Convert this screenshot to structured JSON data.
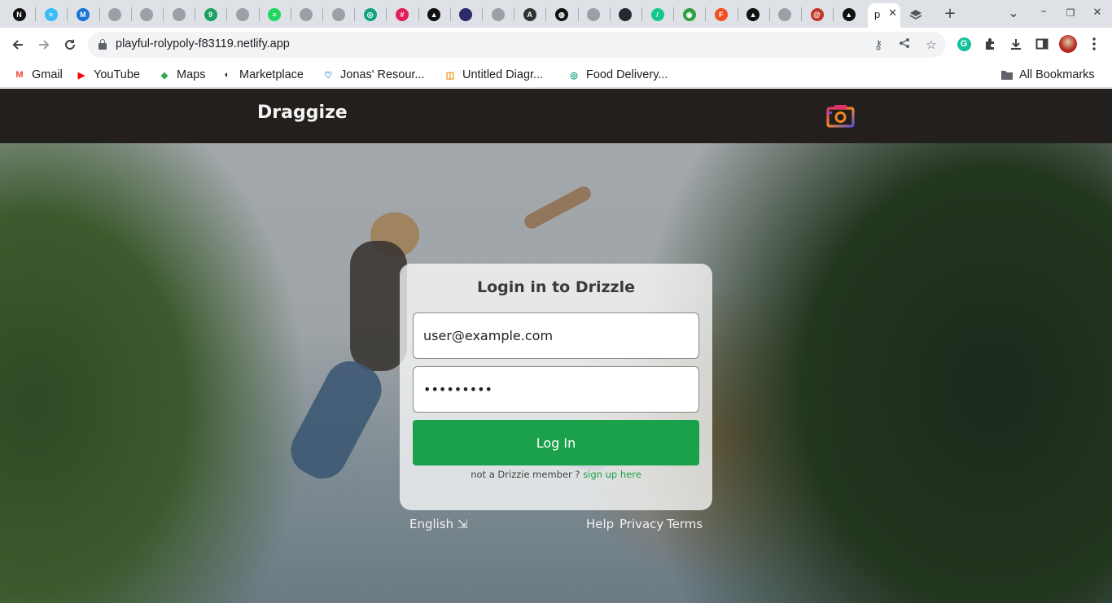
{
  "browser": {
    "tabs": [
      {
        "icon": "notion-icon",
        "color": "#111111",
        "glyph": "N"
      },
      {
        "icon": "tailwind-icon",
        "color": "#38bdf8",
        "glyph": "≈"
      },
      {
        "icon": "mui-icon",
        "color": "#1976d2",
        "glyph": "M"
      },
      {
        "icon": "globe-icon",
        "color": "#9aa0a6",
        "glyph": ""
      },
      {
        "icon": "globe-icon",
        "color": "#9aa0a6",
        "glyph": ""
      },
      {
        "icon": "globe-icon",
        "color": "#9aa0a6",
        "glyph": ""
      },
      {
        "icon": "nine-icon",
        "color": "#1aa260",
        "glyph": "9"
      },
      {
        "icon": "globe-icon",
        "color": "#9aa0a6",
        "glyph": ""
      },
      {
        "icon": "spotify-icon",
        "color": "#1ed760",
        "glyph": "≡"
      },
      {
        "icon": "github-icon",
        "color": "#9aa0a6",
        "glyph": ""
      },
      {
        "icon": "github-icon",
        "color": "#9aa0a6",
        "glyph": ""
      },
      {
        "icon": "chatgpt-icon",
        "color": "#10a37f",
        "glyph": "◎"
      },
      {
        "icon": "slack-icon",
        "color": "#e01e5a",
        "glyph": "#"
      },
      {
        "icon": "vercel-icon",
        "color": "#111111",
        "glyph": "▲"
      },
      {
        "icon": "profile-icon",
        "color": "#2b2b6b",
        "glyph": ""
      },
      {
        "icon": "globe-icon",
        "color": "#9aa0a6",
        "glyph": ""
      },
      {
        "icon": "a-icon",
        "color": "#333333",
        "glyph": "A"
      },
      {
        "icon": "openai-icon",
        "color": "#111111",
        "glyph": "◍"
      },
      {
        "icon": "github-icon",
        "color": "#9aa0a6",
        "glyph": ""
      },
      {
        "icon": "github-icon",
        "color": "#24292f",
        "glyph": ""
      },
      {
        "icon": "pencil-icon",
        "color": "#14c78a",
        "glyph": "/"
      },
      {
        "icon": "green-icon",
        "color": "#2e9e3f",
        "glyph": "◉"
      },
      {
        "icon": "figma-icon",
        "color": "#f24e1e",
        "glyph": "F"
      },
      {
        "icon": "vercel-icon",
        "color": "#111111",
        "glyph": "▲"
      },
      {
        "icon": "globe-icon",
        "color": "#9aa0a6",
        "glyph": ""
      },
      {
        "icon": "spiral-icon",
        "color": "#c0392b",
        "glyph": "@"
      },
      {
        "icon": "vercel-icon",
        "color": "#111111",
        "glyph": "▲"
      }
    ],
    "active_tab": {
      "label_fragment": "p",
      "close": "✕"
    },
    "extra_tab": {
      "icon": "layers-icon",
      "color": "#444444"
    },
    "new_tab": "+",
    "window_controls": {
      "dropdown": "⌄",
      "minimize": "–",
      "maximize": "❐",
      "close": "✕"
    },
    "url": "playful-rolypoly-f83119.netlify.app",
    "bookmarks": [
      {
        "label": "Gmail",
        "icon": "gmail-icon",
        "glyph": "M",
        "color": "#ea4335"
      },
      {
        "label": "YouTube",
        "icon": "youtube-icon",
        "glyph": "▶",
        "color": "#ff0000"
      },
      {
        "label": "Maps",
        "icon": "maps-icon",
        "glyph": "◆",
        "color": "#34a853"
      },
      {
        "label": "Marketplace",
        "icon": "marketplace-icon",
        "glyph": "◐",
        "color": "#222222"
      },
      {
        "label": "Jonas' Resour...",
        "icon": "heart-icon",
        "glyph": "♡",
        "color": "#3b8fd8"
      },
      {
        "label": "Untitled Diagr...",
        "icon": "drawio-icon",
        "glyph": "◫",
        "color": "#f08705"
      },
      {
        "label": "Food Delivery...",
        "icon": "chatgpt-icon",
        "glyph": "◎",
        "color": "#10a37f"
      }
    ],
    "all_bookmarks": "All Bookmarks"
  },
  "app": {
    "brand": "Draggize",
    "camera_icon": "camera-icon",
    "login": {
      "title": "Login in to Drizzle",
      "email_value": "user@example.com",
      "password_value": "•••••••••",
      "button": "Log In",
      "signup_prefix": "not a Drizzie member ?",
      "signup_link": "sign up here"
    },
    "footer": {
      "language": "English ⇲",
      "help": "Help",
      "privacy": "Privacy",
      "terms": "Terms"
    },
    "colors": {
      "header_bg": "#231f1d",
      "accent": "#1ba14a"
    }
  }
}
